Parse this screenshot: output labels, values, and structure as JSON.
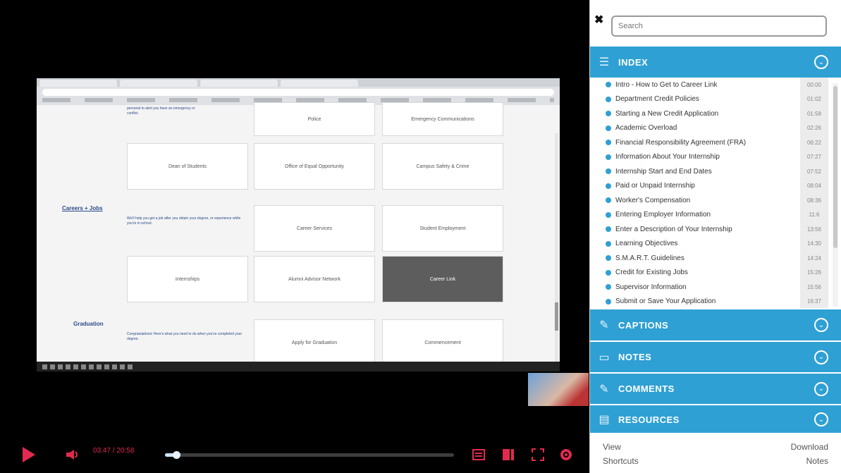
{
  "player": {
    "time": "03:47 / 20:58",
    "progress_fraction": 0.04,
    "play_icon": "play-icon",
    "volume_icon": "volume-icon",
    "colors": {
      "accent": "#e2294f",
      "seek_fill": "#cfe3f3"
    }
  },
  "video_page": {
    "tiles_row1": [
      "Police",
      "Emergency Communications"
    ],
    "tiles_row2": [
      "Dean of Students",
      "Office of Equal Opportunity",
      "Campus Safety & Crime"
    ],
    "career_title": "Careers + Jobs",
    "career_desc": "We'll help you get a job after you obtain your degree, or experience while you're in school.",
    "tiles_row3": [
      "Career Services",
      "Student Employment"
    ],
    "tiles_row4": [
      "Internships",
      "Alumni Advisor Network",
      "Career Link"
    ],
    "graduation_title": "Graduation",
    "graduation_desc": "Congratulations! Here's what you need to do when you've completed your degree.",
    "tiles_row5": [
      "Apply for Graduation",
      "Commencement"
    ],
    "top_desc": "personal to alert you have an emergency or conflict."
  },
  "sidebar": {
    "search_placeholder": "Search",
    "close_icon": "close-icon",
    "index": {
      "title": "INDEX",
      "items": [
        {
          "title": "Intro - How to Get to Career Link",
          "ts": "00:00"
        },
        {
          "title": "Department Credit Policies",
          "ts": "01:02"
        },
        {
          "title": "Starting a New Credit Application",
          "ts": "01:58"
        },
        {
          "title": "Academic Overload",
          "ts": "02:26"
        },
        {
          "title": "Financial Responsibility Agreement (FRA)",
          "ts": "06:22"
        },
        {
          "title": "Information About Your Internship",
          "ts": "07:27"
        },
        {
          "title": "Internship Start and End Dates",
          "ts": "07:52"
        },
        {
          "title": "Paid or Unpaid Internship",
          "ts": "08:04"
        },
        {
          "title": "Worker's Compensation",
          "ts": "08:36"
        },
        {
          "title": "Entering Employer Information",
          "ts": "11:6"
        },
        {
          "title": "Enter a Description of Your Internship",
          "ts": "13:56"
        },
        {
          "title": "Learning Objectives",
          "ts": "14:30"
        },
        {
          "title": "S.M.A.R.T. Guidelines",
          "ts": "14:24"
        },
        {
          "title": "Credit for Existing Jobs",
          "ts": "15:26"
        },
        {
          "title": "Supervisor Information",
          "ts": "15:56"
        },
        {
          "title": "Submit or Save Your Application",
          "ts": "16:37"
        }
      ]
    },
    "captions_title": "CAPTIONS",
    "notes_title": "NOTES",
    "comments_title": "COMMENTS",
    "resources_title": "RESOURCES",
    "footer": {
      "view_line1": "View",
      "view_line2": "Shortcuts",
      "download_line1": "Download",
      "download_line2": "Notes"
    },
    "colors": {
      "accent": "#2fa0d4"
    }
  }
}
